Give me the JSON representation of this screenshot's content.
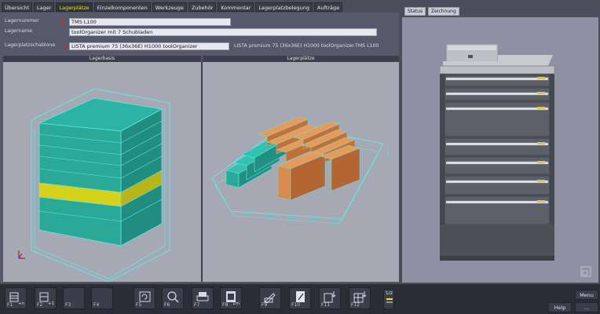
{
  "tabs": [
    "Übersicht",
    "Lager",
    "Lagerplätze",
    "Einzelkomponenten",
    "Werkzeuge",
    "Zubehör",
    "Kommentar",
    "Lagerplatzbelegung",
    "Aufträge"
  ],
  "active_tab": "Lagerplätze",
  "form": {
    "lagernummer_label": "Lagernummer",
    "lagernummer_value": "TMS L100",
    "lagername_label": "Lagername",
    "lagername_value": "toolOrganizer mit 7 Schubladen",
    "schablone_label": "Lagerplatzschablone",
    "schablone_value": "LISTA premium 75 (36x36E) H1000 toolOrganizer",
    "schablone_desc": "LISTA premium 75 (36x36E) H1000 toolOrganizer-TMS L100"
  },
  "views": {
    "left_header": "Lagerbasis",
    "right_header": "Lagerplätze"
  },
  "right_tabs": [
    "Status",
    "Zeichnung"
  ],
  "function_keys": [
    {
      "label": "F1",
      "icon": "add-drawer-icon",
      "extra": "+n"
    },
    {
      "label": "F2",
      "icon": "add-one-icon",
      "extra": "+1"
    },
    {
      "label": "F3",
      "icon": "empty-icon",
      "extra": ""
    },
    {
      "label": "F4",
      "icon": "empty-icon",
      "extra": ""
    },
    {
      "label": "F5",
      "icon": "refresh-icon",
      "extra": ""
    },
    {
      "label": "F6",
      "icon": "zoom-icon",
      "extra": ""
    },
    {
      "label": "F7",
      "icon": "print-icon",
      "extra": ""
    },
    {
      "label": "F8",
      "icon": "list-icon",
      "extra": "1m"
    },
    {
      "label": "F9",
      "icon": "edit-icon",
      "extra": ""
    },
    {
      "label": "F10",
      "icon": "document-icon",
      "extra": ""
    },
    {
      "label": "F11",
      "icon": "stock-in-icon",
      "extra": ""
    },
    {
      "label": "F12",
      "icon": "grid-icon",
      "extra": ""
    }
  ],
  "page_indicator": "1/2",
  "side_buttons": {
    "menu": "Menu",
    "help": "Help",
    "more": "..."
  },
  "colors": {
    "accent": "#f2e600",
    "box_teal": "#2bb3a3",
    "box_highlight": "#d6d21a",
    "box_orange": "#d98a4c",
    "outline_cyan": "#62e6e6"
  }
}
